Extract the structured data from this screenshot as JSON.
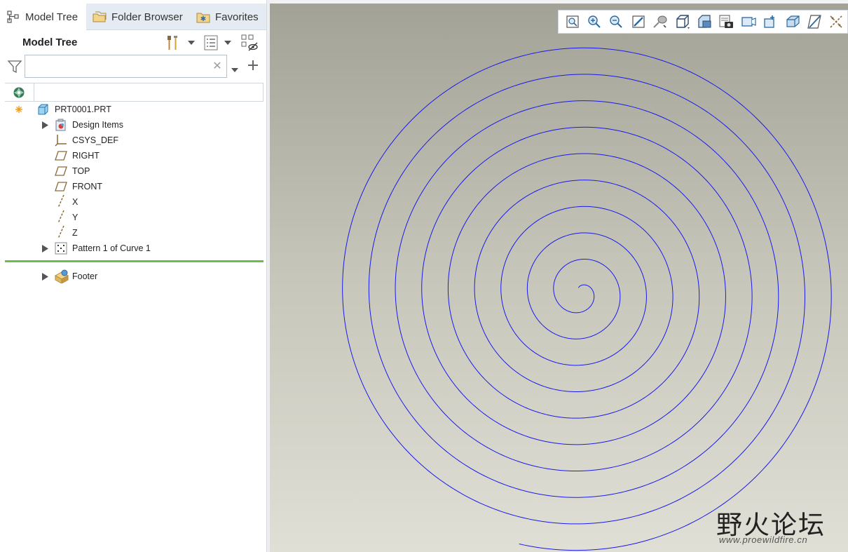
{
  "tabs": [
    {
      "label": "Model Tree",
      "icon": "model-tree-icon",
      "active": true
    },
    {
      "label": "Folder Browser",
      "icon": "folder-browser-icon",
      "active": false
    },
    {
      "label": "Favorites",
      "icon": "favorites-icon",
      "active": false
    }
  ],
  "tree_panel": {
    "title": "Model Tree",
    "header_icons": [
      "settings-tools-icon",
      "show-list-icon",
      "show-hide-icon"
    ]
  },
  "search": {
    "value": "",
    "placeholder": "",
    "clear_glyph": "✕"
  },
  "tree": {
    "root": {
      "label": "PRT0001.PRT",
      "icon": "part-icon"
    },
    "items": [
      {
        "label": "Design Items",
        "icon": "design-items-icon",
        "expandable": true
      },
      {
        "label": "CSYS_DEF",
        "icon": "csys-icon",
        "expandable": false
      },
      {
        "label": "RIGHT",
        "icon": "datum-plane-icon",
        "expandable": false
      },
      {
        "label": "TOP",
        "icon": "datum-plane-icon",
        "expandable": false
      },
      {
        "label": "FRONT",
        "icon": "datum-plane-icon",
        "expandable": false
      },
      {
        "label": "X",
        "icon": "datum-axis-icon",
        "expandable": false
      },
      {
        "label": "Y",
        "icon": "datum-axis-icon",
        "expandable": false
      },
      {
        "label": "Z",
        "icon": "datum-axis-icon",
        "expandable": false
      },
      {
        "label": "Pattern 1 of Curve 1",
        "icon": "pattern-icon",
        "expandable": true
      }
    ],
    "footer": {
      "label": "Footer",
      "icon": "footer-icon",
      "expandable": true
    }
  },
  "view_toolbar": [
    "refit-icon",
    "zoom-in-icon",
    "zoom-out-icon",
    "repaint-icon",
    "spin-center-icon",
    "display-style-icon",
    "saved-orientations-icon",
    "view-manager-icon",
    "perspective-icon",
    "annotation-display-icon",
    "datum-display-icon",
    "section-icon",
    "plane-display-icon",
    "point-display-icon"
  ],
  "graphics": {
    "spiral_color": "#1a1aee",
    "background_top": "#a3a296",
    "background_bottom": "#e0dfd6"
  },
  "watermark": {
    "title": "野火论坛",
    "url": "www.proewildfire.cn"
  },
  "colors": {
    "accent_green": "#6cc04a",
    "tab_inactive": "#e4ebf2"
  }
}
